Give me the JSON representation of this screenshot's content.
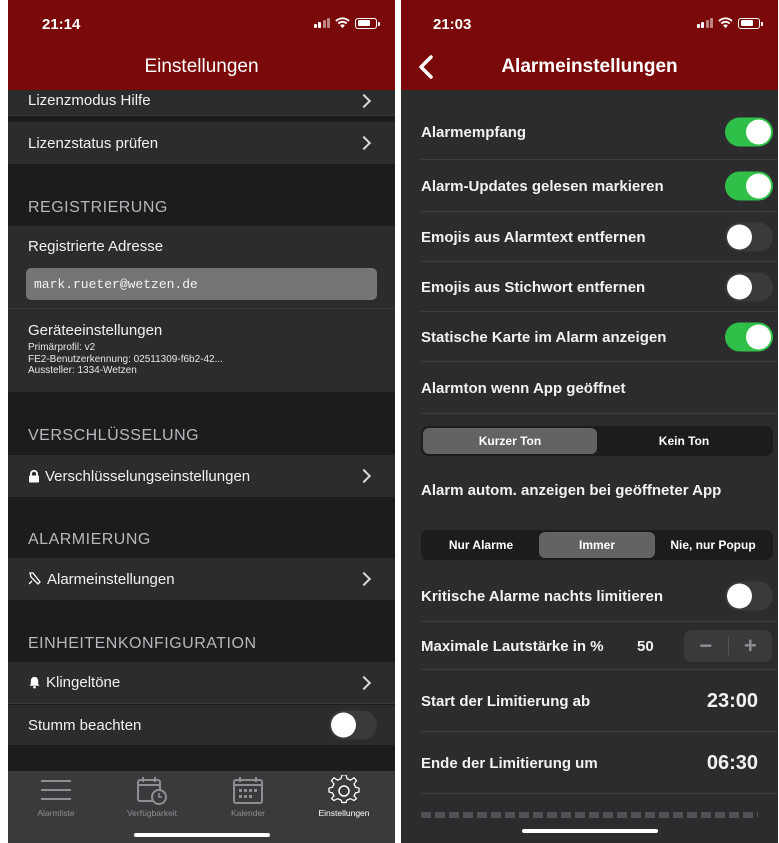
{
  "left": {
    "status_time": "21:14",
    "nav_title": "Einstellungen",
    "rows": {
      "license_help": "Lizenzmodus Hilfe",
      "license_check": "Lizenzstatus prüfen"
    },
    "sections": {
      "registration": "REGISTRIERUNG",
      "encryption": "VERSCHLÜSSELUNG",
      "alarming": "ALARMIERUNG",
      "unit_config": "EINHEITENKONFIGURATION"
    },
    "registered_address_label": "Registrierte Adresse",
    "registered_address_value": "mark.rueter@wetzen.de",
    "device_settings": {
      "title": "Geräteeinstellungen",
      "line1": "Primärprofil: v2",
      "line2": "FE2-Benutzerkennung: 02511309-f6b2-42...",
      "line3": "Aussteller: 1334-Wetzen"
    },
    "encryption_settings": "Verschlüsselungseinstellungen",
    "alarm_settings": "Alarmeinstellungen",
    "ringtones": "Klingeltöne",
    "respect_mute": "Stumm beachten",
    "respect_mute_on": false,
    "tabs": [
      {
        "label": "Alarmliste",
        "active": false
      },
      {
        "label": "Verfügbarkeit",
        "active": false
      },
      {
        "label": "Kalender",
        "active": false
      },
      {
        "label": "Einstellungen",
        "active": true
      }
    ]
  },
  "right": {
    "status_time": "21:03",
    "nav_title": "Alarmeinstellungen",
    "toggles": [
      {
        "label": "Alarmempfang",
        "on": true
      },
      {
        "label": "Alarm-Updates gelesen markieren",
        "on": true
      },
      {
        "label": "Emojis aus Alarmtext entfernen",
        "on": false
      },
      {
        "label": "Emojis aus Stichwort entfernen",
        "on": false
      },
      {
        "label": "Statische Karte im Alarm anzeigen",
        "on": true
      }
    ],
    "alarm_tone_label": "Alarmton wenn App geöffnet",
    "alarm_tone_options": [
      "Kurzer Ton",
      "Kein Ton"
    ],
    "alarm_tone_selected": "Kurzer Ton",
    "auto_show_label": "Alarm autom. anzeigen bei geöffneter App",
    "auto_show_options": [
      "Nur Alarme",
      "Immer",
      "Nie, nur Popup"
    ],
    "auto_show_selected": "Immer",
    "critical_limit_label": "Kritische Alarme nachts limitieren",
    "critical_limit_on": false,
    "max_volume_label": "Maximale Lautstärke in %",
    "max_volume_value": "50",
    "stepper_minus": "−",
    "stepper_plus": "+",
    "limit_start_label": "Start der Limitierung ab",
    "limit_start_value": "23:00",
    "limit_end_label": "Ende der Limitierung um",
    "limit_end_value": "06:30",
    "colors": {
      "nav": "#7a0a0a",
      "toggle_on": "#30c04a",
      "background": "#2c2c2e"
    }
  }
}
